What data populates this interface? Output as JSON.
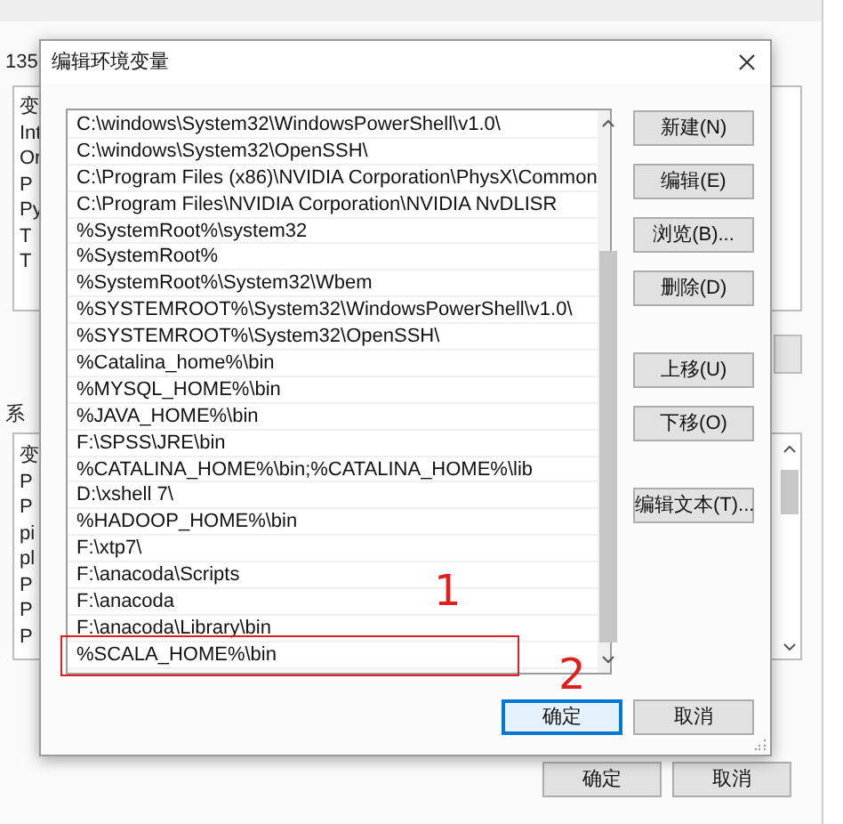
{
  "background_window": {
    "user_label": "135",
    "user_variables": {
      "header": "变",
      "rows": [
        "Int",
        "Or",
        "P",
        "Py",
        "T",
        "T"
      ]
    },
    "system_label": "系",
    "system_variables": {
      "header": "变",
      "rows": [
        "P",
        "P",
        "pi",
        "pl",
        "P",
        "P",
        "P"
      ]
    },
    "buttons": [
      {
        "label": "确定"
      },
      {
        "label": "取消"
      }
    ]
  },
  "dialog": {
    "title": "编辑环境变量",
    "entries": [
      {
        "text": "C:\\windows\\System32\\WindowsPowerShell\\v1.0\\",
        "marked": false
      },
      {
        "text": "C:\\windows\\System32\\OpenSSH\\",
        "marked": false
      },
      {
        "text": "C:\\Program Files (x86)\\NVIDIA Corporation\\PhysX\\Common",
        "marked": false
      },
      {
        "text": "C:\\Program Files\\NVIDIA Corporation\\NVIDIA NvDLISR",
        "marked": false
      },
      {
        "text": "%SystemRoot%\\system32",
        "marked": false
      },
      {
        "text": "%SystemRoot%",
        "marked": false
      },
      {
        "text": "%SystemRoot%\\System32\\Wbem",
        "marked": false
      },
      {
        "text": "%SYSTEMROOT%\\System32\\WindowsPowerShell\\v1.0\\",
        "marked": false
      },
      {
        "text": "%SYSTEMROOT%\\System32\\OpenSSH\\",
        "marked": false
      },
      {
        "text": "%Catalina_home%\\bin",
        "marked": false
      },
      {
        "text": "%MYSQL_HOME%\\bin",
        "marked": false
      },
      {
        "text": "%JAVA_HOME%\\bin",
        "marked": false
      },
      {
        "text": "F:\\SPSS\\JRE\\bin",
        "marked": false
      },
      {
        "text": "%CATALINA_HOME%\\bin;%CATALINA_HOME%\\lib",
        "marked": false
      },
      {
        "text": "D:\\xshell 7\\",
        "marked": false
      },
      {
        "text": "%HADOOP_HOME%\\bin",
        "marked": false
      },
      {
        "text": "F:\\xtp7\\",
        "marked": false
      },
      {
        "text": "F:\\anacoda\\Scripts",
        "marked": false
      },
      {
        "text": "F:\\anacoda",
        "marked": false
      },
      {
        "text": "F:\\anacoda\\Library\\bin",
        "marked": false
      },
      {
        "text": "%SCALA_HOME%\\bin",
        "marked": true
      }
    ],
    "button_groups": [
      [
        {
          "label": "新建(N)"
        },
        {
          "label": "编辑(E)"
        },
        {
          "label": "浏览(B)..."
        },
        {
          "label": "删除(D)"
        }
      ],
      [
        {
          "label": "上移(U)"
        },
        {
          "label": "下移(O)"
        }
      ],
      [
        {
          "label": "编辑文本(T)..."
        }
      ]
    ],
    "footer_buttons": [
      {
        "label": "确定",
        "focused": true
      },
      {
        "label": "取消",
        "focused": false
      }
    ]
  },
  "annotations": [
    {
      "label": "1"
    },
    {
      "label": "2"
    }
  ]
}
